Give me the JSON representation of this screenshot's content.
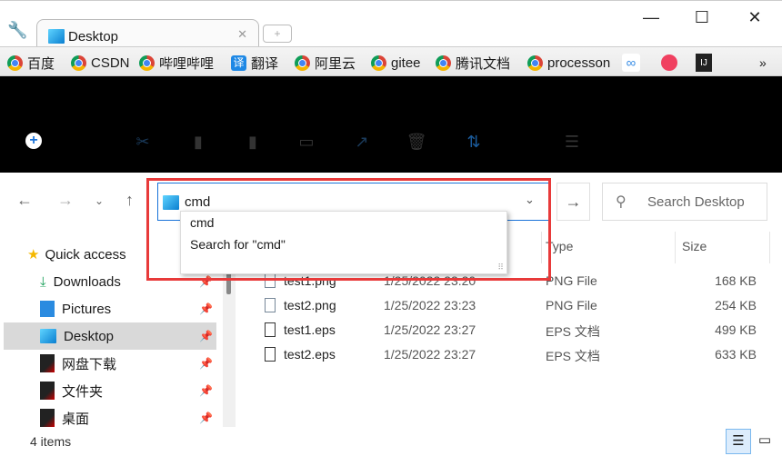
{
  "browser": {
    "tab_title": "Desktop",
    "window_controls": [
      "minimize",
      "maximize",
      "close"
    ],
    "bookmarks": [
      {
        "label": "百度",
        "icon": "chrome-icon"
      },
      {
        "label": "CSDN",
        "icon": "chrome-icon"
      },
      {
        "label": "哔哩哔哩",
        "icon": "chrome-icon"
      },
      {
        "label": "翻译",
        "icon": "translate-icon"
      },
      {
        "label": "阿里云",
        "icon": "chrome-icon"
      },
      {
        "label": "gitee",
        "icon": "chrome-icon"
      },
      {
        "label": "腾讯文档",
        "icon": "chrome-icon"
      },
      {
        "label": "processon",
        "icon": "chrome-icon"
      }
    ],
    "overflow": "»"
  },
  "address": {
    "value": "cmd",
    "suggestions": [
      "cmd",
      "Search for \"cmd\""
    ]
  },
  "search": {
    "placeholder": "Search Desktop"
  },
  "sidebar": {
    "items": [
      {
        "label": "Quick access",
        "icon": "star-icon"
      },
      {
        "label": "Downloads",
        "icon": "download-icon"
      },
      {
        "label": "Pictures",
        "icon": "pictures-icon"
      },
      {
        "label": "Desktop",
        "icon": "desktop-folder-icon",
        "selected": true
      },
      {
        "label": "网盘下载",
        "icon": "app-folder-icon"
      },
      {
        "label": "文件夹",
        "icon": "app-folder-icon"
      },
      {
        "label": "桌面",
        "icon": "app-folder-icon"
      }
    ]
  },
  "columns": {
    "type": "Type",
    "size": "Size"
  },
  "files": [
    {
      "name": "test1.png",
      "date": "1/25/2022 23:20",
      "type": "PNG File",
      "size": "168 KB"
    },
    {
      "name": "test2.png",
      "date": "1/25/2022 23:23",
      "type": "PNG File",
      "size": "254 KB"
    },
    {
      "name": "test1.eps",
      "date": "1/25/2022 23:27",
      "type": "EPS 文档",
      "size": "499 KB"
    },
    {
      "name": "test2.eps",
      "date": "1/25/2022 23:27",
      "type": "EPS 文档",
      "size": "633 KB"
    }
  ],
  "status": {
    "count": "4 items"
  },
  "colors": {
    "highlight": "#e83a3a",
    "accent": "#1a73d9"
  }
}
